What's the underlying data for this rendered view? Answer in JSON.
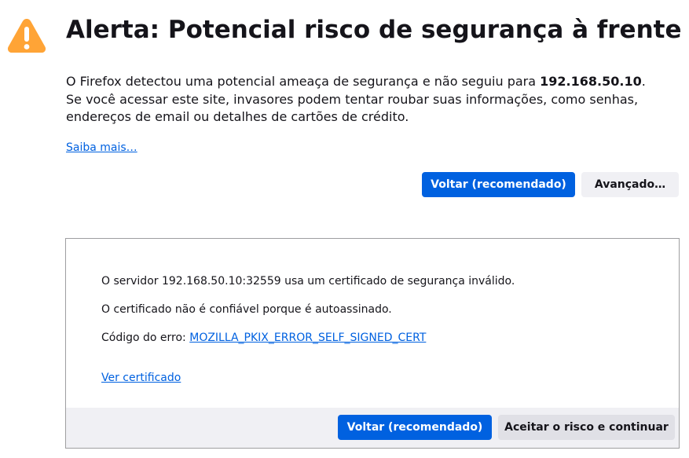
{
  "page": {
    "title": "Alerta: Potencial risco de segurança à frente",
    "description_prefix": "O Firefox detectou uma potencial ameaça de segurança e não seguiu para ",
    "host": "192.168.50.10",
    "description_suffix": ". Se você acessar este site, invasores podem tentar roubar suas informações, como senhas, endereços de email ou detalhes de cartões de crédito.",
    "learn_more_label": "Saiba mais…",
    "back_button_label": "Voltar (recomendado)",
    "advanced_button_label": "Avançado…"
  },
  "advanced": {
    "line1": "O servidor 192.168.50.10:32559 usa um certificado de segurança inválido.",
    "line2": "O certificado não é confiável porque é autoassinado.",
    "error_prefix": "Código do erro: ",
    "error_code": "MOZILLA_PKIX_ERROR_SELF_SIGNED_CERT",
    "view_certificate_label": "Ver certificado",
    "back_button_label": "Voltar (recomendado)",
    "accept_button_label": "Aceitar o risco e continuar"
  },
  "colors": {
    "accent": "#0061e0",
    "warning_icon": "#ffa436",
    "text": "#15141a",
    "secondary_button": "#f0f0f4"
  },
  "icons": {
    "warning": "warning-triangle-icon"
  }
}
